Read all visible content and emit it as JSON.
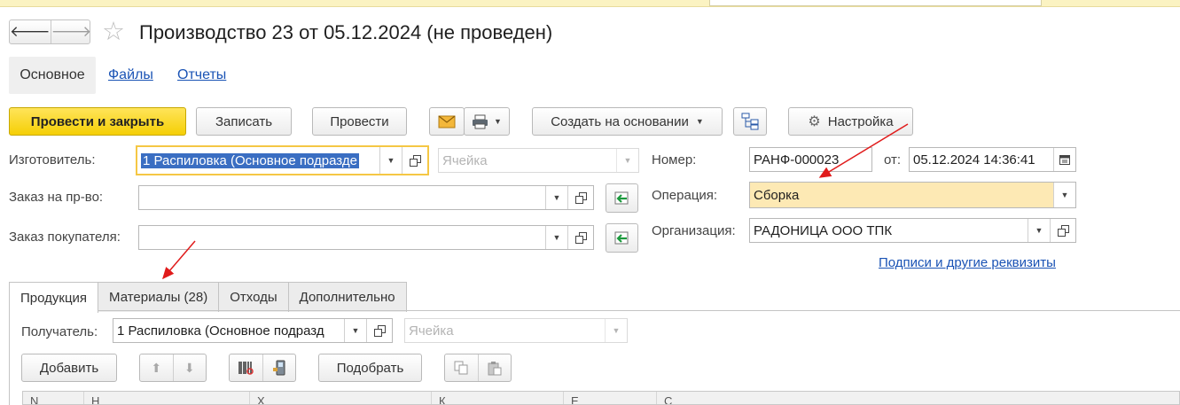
{
  "window": {
    "title": "Производство 23 от 05.12.2024 (не проведен)",
    "nav_back": "🡐",
    "nav_forward": "🡒",
    "favorite_icon": "star-icon"
  },
  "sections": {
    "active": "Основное",
    "links": [
      "Файлы",
      "Отчеты"
    ]
  },
  "toolbar": {
    "post_close": "Провести и закрыть",
    "save": "Записать",
    "post": "Провести",
    "create_based": "Создать на основании",
    "settings": "Настройка"
  },
  "form": {
    "manufacturer_label": "Изготовитель:",
    "manufacturer_value": "1 Распиловка (Основное подразде",
    "cell_placeholder": "Ячейка",
    "prod_order_label": "Заказ на пр-во:",
    "prod_order_value": "",
    "customer_order_label": "Заказ покупателя:",
    "customer_order_value": "",
    "number_label": "Номер:",
    "number_value": "РАНФ-000023",
    "date_label": "от:",
    "date_value": "05.12.2024 14:36:41",
    "operation_label": "Операция:",
    "operation_value": "Сборка",
    "organization_label": "Организация:",
    "organization_value": "РАДОНИЦА ООО ТПК",
    "signatures_link": "Подписи и другие реквизиты"
  },
  "tabs": [
    {
      "label": "Продукция",
      "active": true
    },
    {
      "label": "Материалы (28)",
      "active": false
    },
    {
      "label": "Отходы",
      "active": false
    },
    {
      "label": "Дополнительно",
      "active": false
    }
  ],
  "products_tab": {
    "recipient_label": "Получатель:",
    "recipient_value": "1 Распиловка (Основное подразд",
    "cell_placeholder": "Ячейка",
    "add": "Добавить",
    "pick": "Подобрать",
    "table_columns": [
      "N",
      "Н",
      "Х",
      "К",
      "Е",
      "С"
    ]
  },
  "colors": {
    "accent_yellow": "#f5cf05",
    "operation_highlight": "#fde9b4",
    "link_blue": "#1a53b5",
    "arrow_red": "#e01b1b"
  }
}
